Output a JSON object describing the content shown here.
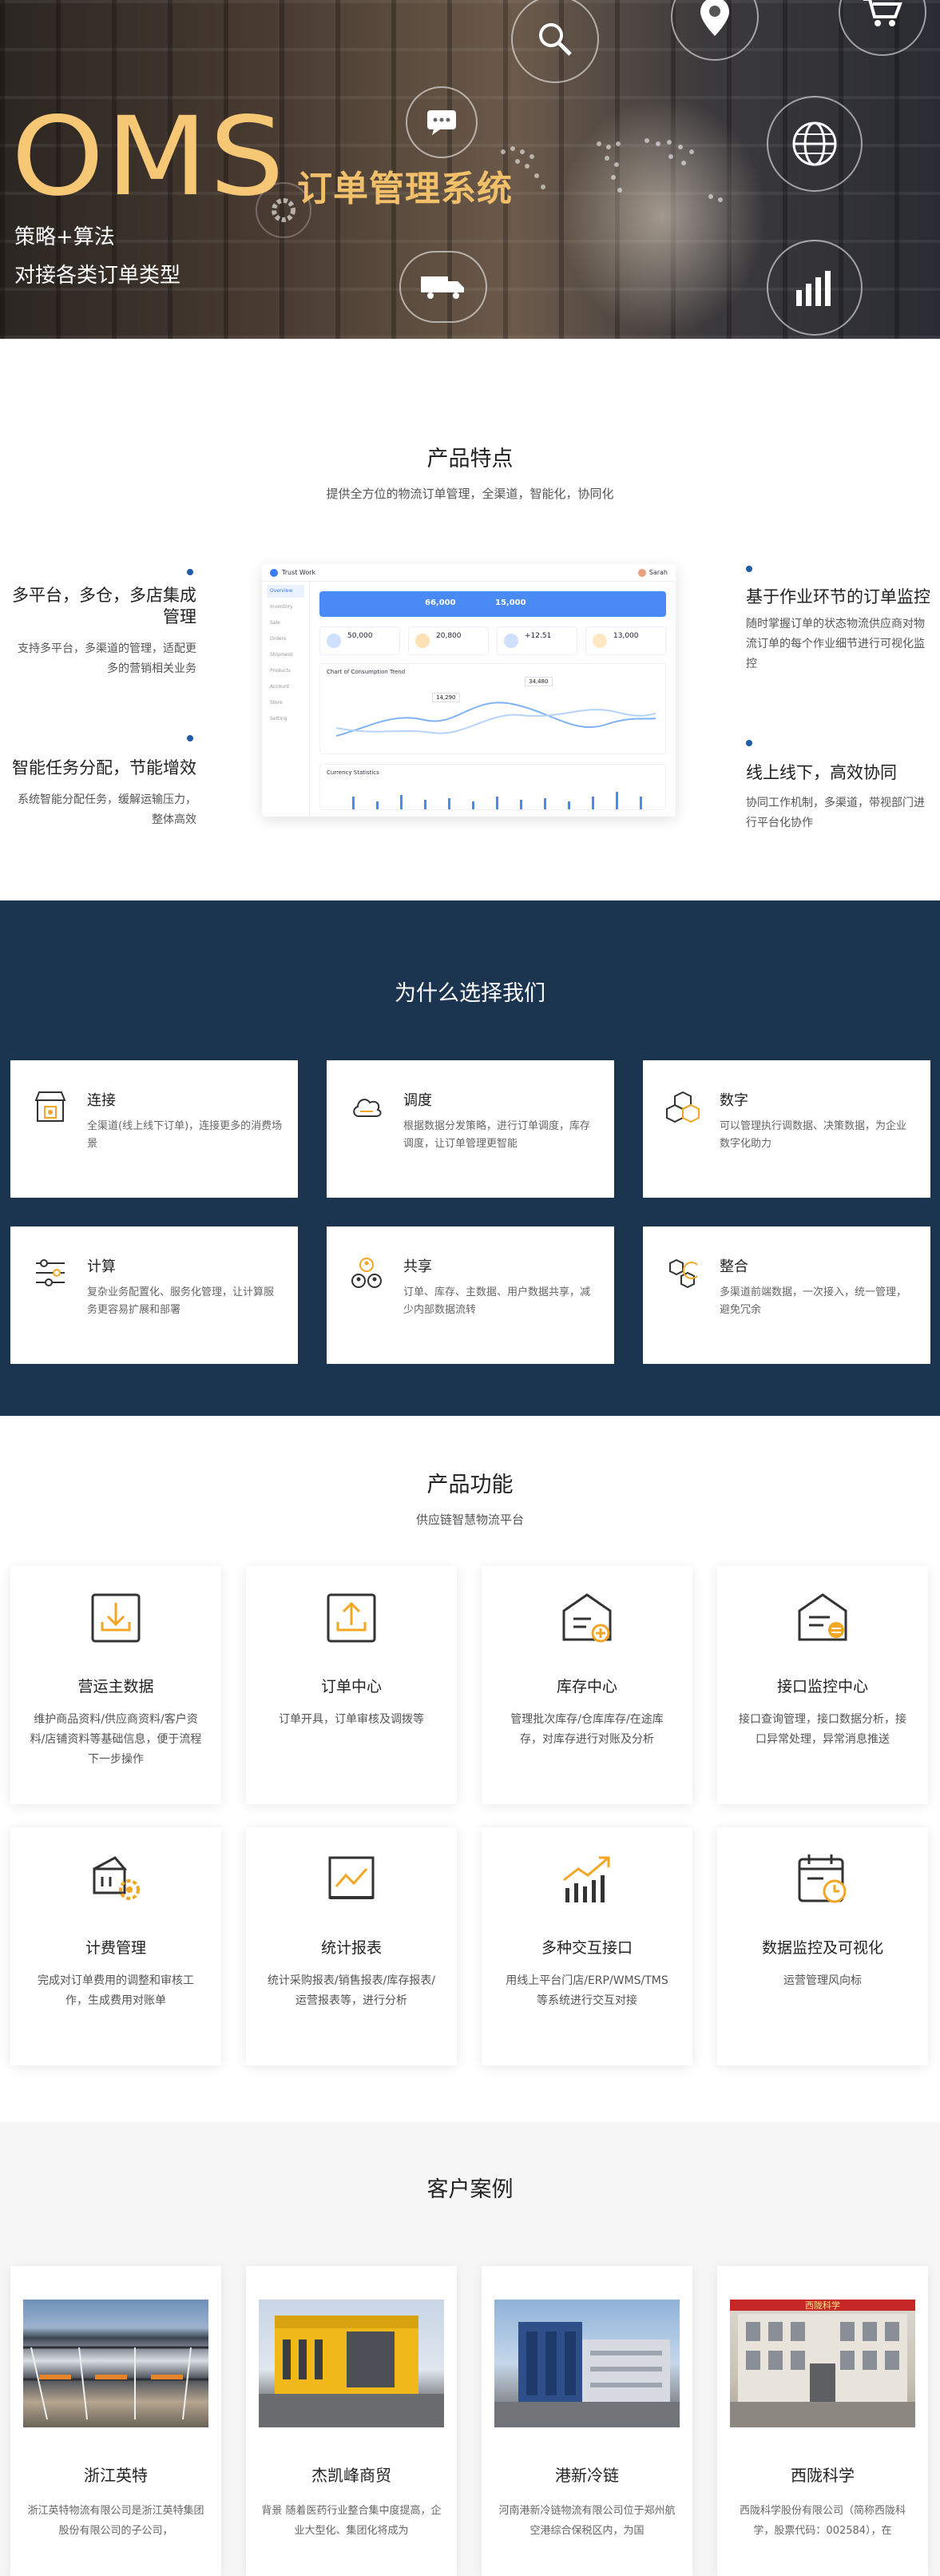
{
  "hero": {
    "brand": "OMS",
    "system_name": "订单管理系统",
    "line1": "策略+算法",
    "line2": "对接各类订单类型"
  },
  "features": {
    "title": "产品特点",
    "subtitle": "提供全方位的物流订单管理，全渠道，智能化，协同化",
    "items": [
      {
        "title": "多平台，多仓，多店集成管理",
        "desc": "支持多平台，多渠道的管理，适配更多的营销相关业务"
      },
      {
        "title": "智能任务分配，节能增效",
        "desc": "系统智能分配任务，缓解运输压力，整体高效"
      },
      {
        "title": "基于作业环节的订单监控",
        "desc": "随时掌握订单的状态物流供应商对物流订单的每个作业细节进行可视化监控"
      },
      {
        "title": "线上线下，高效协同",
        "desc": "协同工作机制，多渠道，带视部门进行平台化协作"
      }
    ],
    "dashboard": {
      "app_name": "Trust Work",
      "user": "Sarah",
      "nav": [
        "Overview",
        "Inventory",
        "Sale",
        "Orders",
        "Shipment",
        "Products",
        "Account",
        "Store",
        "Setting"
      ],
      "banner_a": "66,000",
      "banner_b": "15,000",
      "kpis": [
        "50,000",
        "20,800",
        "+12.51",
        "13,000"
      ],
      "chart_title": "Chart of Consumption Trend",
      "tooltip_a": "14,290",
      "tooltip_b": "34,480",
      "bars_title": "Currency Statistics"
    }
  },
  "why": {
    "title": "为什么选择我们",
    "cards": [
      {
        "icon": "store-icon",
        "title": "连接",
        "desc": "全渠道(线上线下订单)，连接更多的消费场景"
      },
      {
        "icon": "cloud-icon",
        "title": "调度",
        "desc": "根据数据分发策略，进行订单调度，库存调度，让订单管理更智能"
      },
      {
        "icon": "cubes-icon",
        "title": "数字",
        "desc": "可以管理执行调数据、决策数据，为企业数字化助力"
      },
      {
        "icon": "sliders-icon",
        "title": "计算",
        "desc": "复杂业务配置化、服务化管理，让计算服务更容易扩展和部署"
      },
      {
        "icon": "users-share-icon",
        "title": "共享",
        "desc": "订单、库存、主数据、用户数据共享，减少内部数据流转"
      },
      {
        "icon": "integrate-icon",
        "title": "整合",
        "desc": "多渠道前端数据，一次接入，统一管理，避免冗余"
      }
    ]
  },
  "functions": {
    "title": "产品功能",
    "subtitle": "供应链智慧物流平台",
    "items": [
      {
        "icon": "download-tray-icon",
        "title": "营运主数据",
        "desc": "维护商品资料/供应商资料/客户资料/店铺资料等基础信息，便于流程下一步操作"
      },
      {
        "icon": "upload-tray-icon",
        "title": "订单中心",
        "desc": "订单开具，订单审核及调拨等"
      },
      {
        "icon": "warehouse-add-icon",
        "title": "库存中心",
        "desc": "管理批次库存/仓库库存/在途库存，对库存进行对账及分析"
      },
      {
        "icon": "monitor-api-icon",
        "title": "接口监控中心",
        "desc": "接口查询管理，接口数据分析，接口异常处理，异常消息推送"
      },
      {
        "icon": "billing-gear-icon",
        "title": "计费管理",
        "desc": "完成对订单费用的调整和审核工作，生成费用对账单"
      },
      {
        "icon": "report-chart-icon",
        "title": "统计报表",
        "desc": "统计采购报表/销售报表/库存报表/运营报表等，进行分析"
      },
      {
        "icon": "growth-chart-icon",
        "title": "多种交互接口",
        "desc": "用线上平台门店/ERP/WMS/TMS等系统进行交互对接"
      },
      {
        "icon": "calendar-clock-icon",
        "title": "数据监控及可视化",
        "desc": "运营管理风向标"
      }
    ]
  },
  "cases": {
    "title": "客户案例",
    "items": [
      {
        "name": "浙江英特",
        "desc": "浙江英特物流有限公司是浙江英特集团股份有限公司的子公司，"
      },
      {
        "name": "杰凯峰商贸",
        "desc": "背景 随着医药行业整合集中度提高，企业大型化、集团化将成为"
      },
      {
        "name": "港新冷链",
        "desc": "河南港新冷链物流有限公司位于郑州航空港综合保税区内，为国"
      },
      {
        "name": "西陇科学",
        "desc": "西陇科学股份有限公司（简称西陇科学，股票代码：002584），在"
      }
    ],
    "sign_text": "西陇科学"
  },
  "colors": {
    "accent": "#f2c06a",
    "navy": "#1b3550",
    "blue": "#1f5ba8",
    "icon_orange": "#f2a623"
  }
}
